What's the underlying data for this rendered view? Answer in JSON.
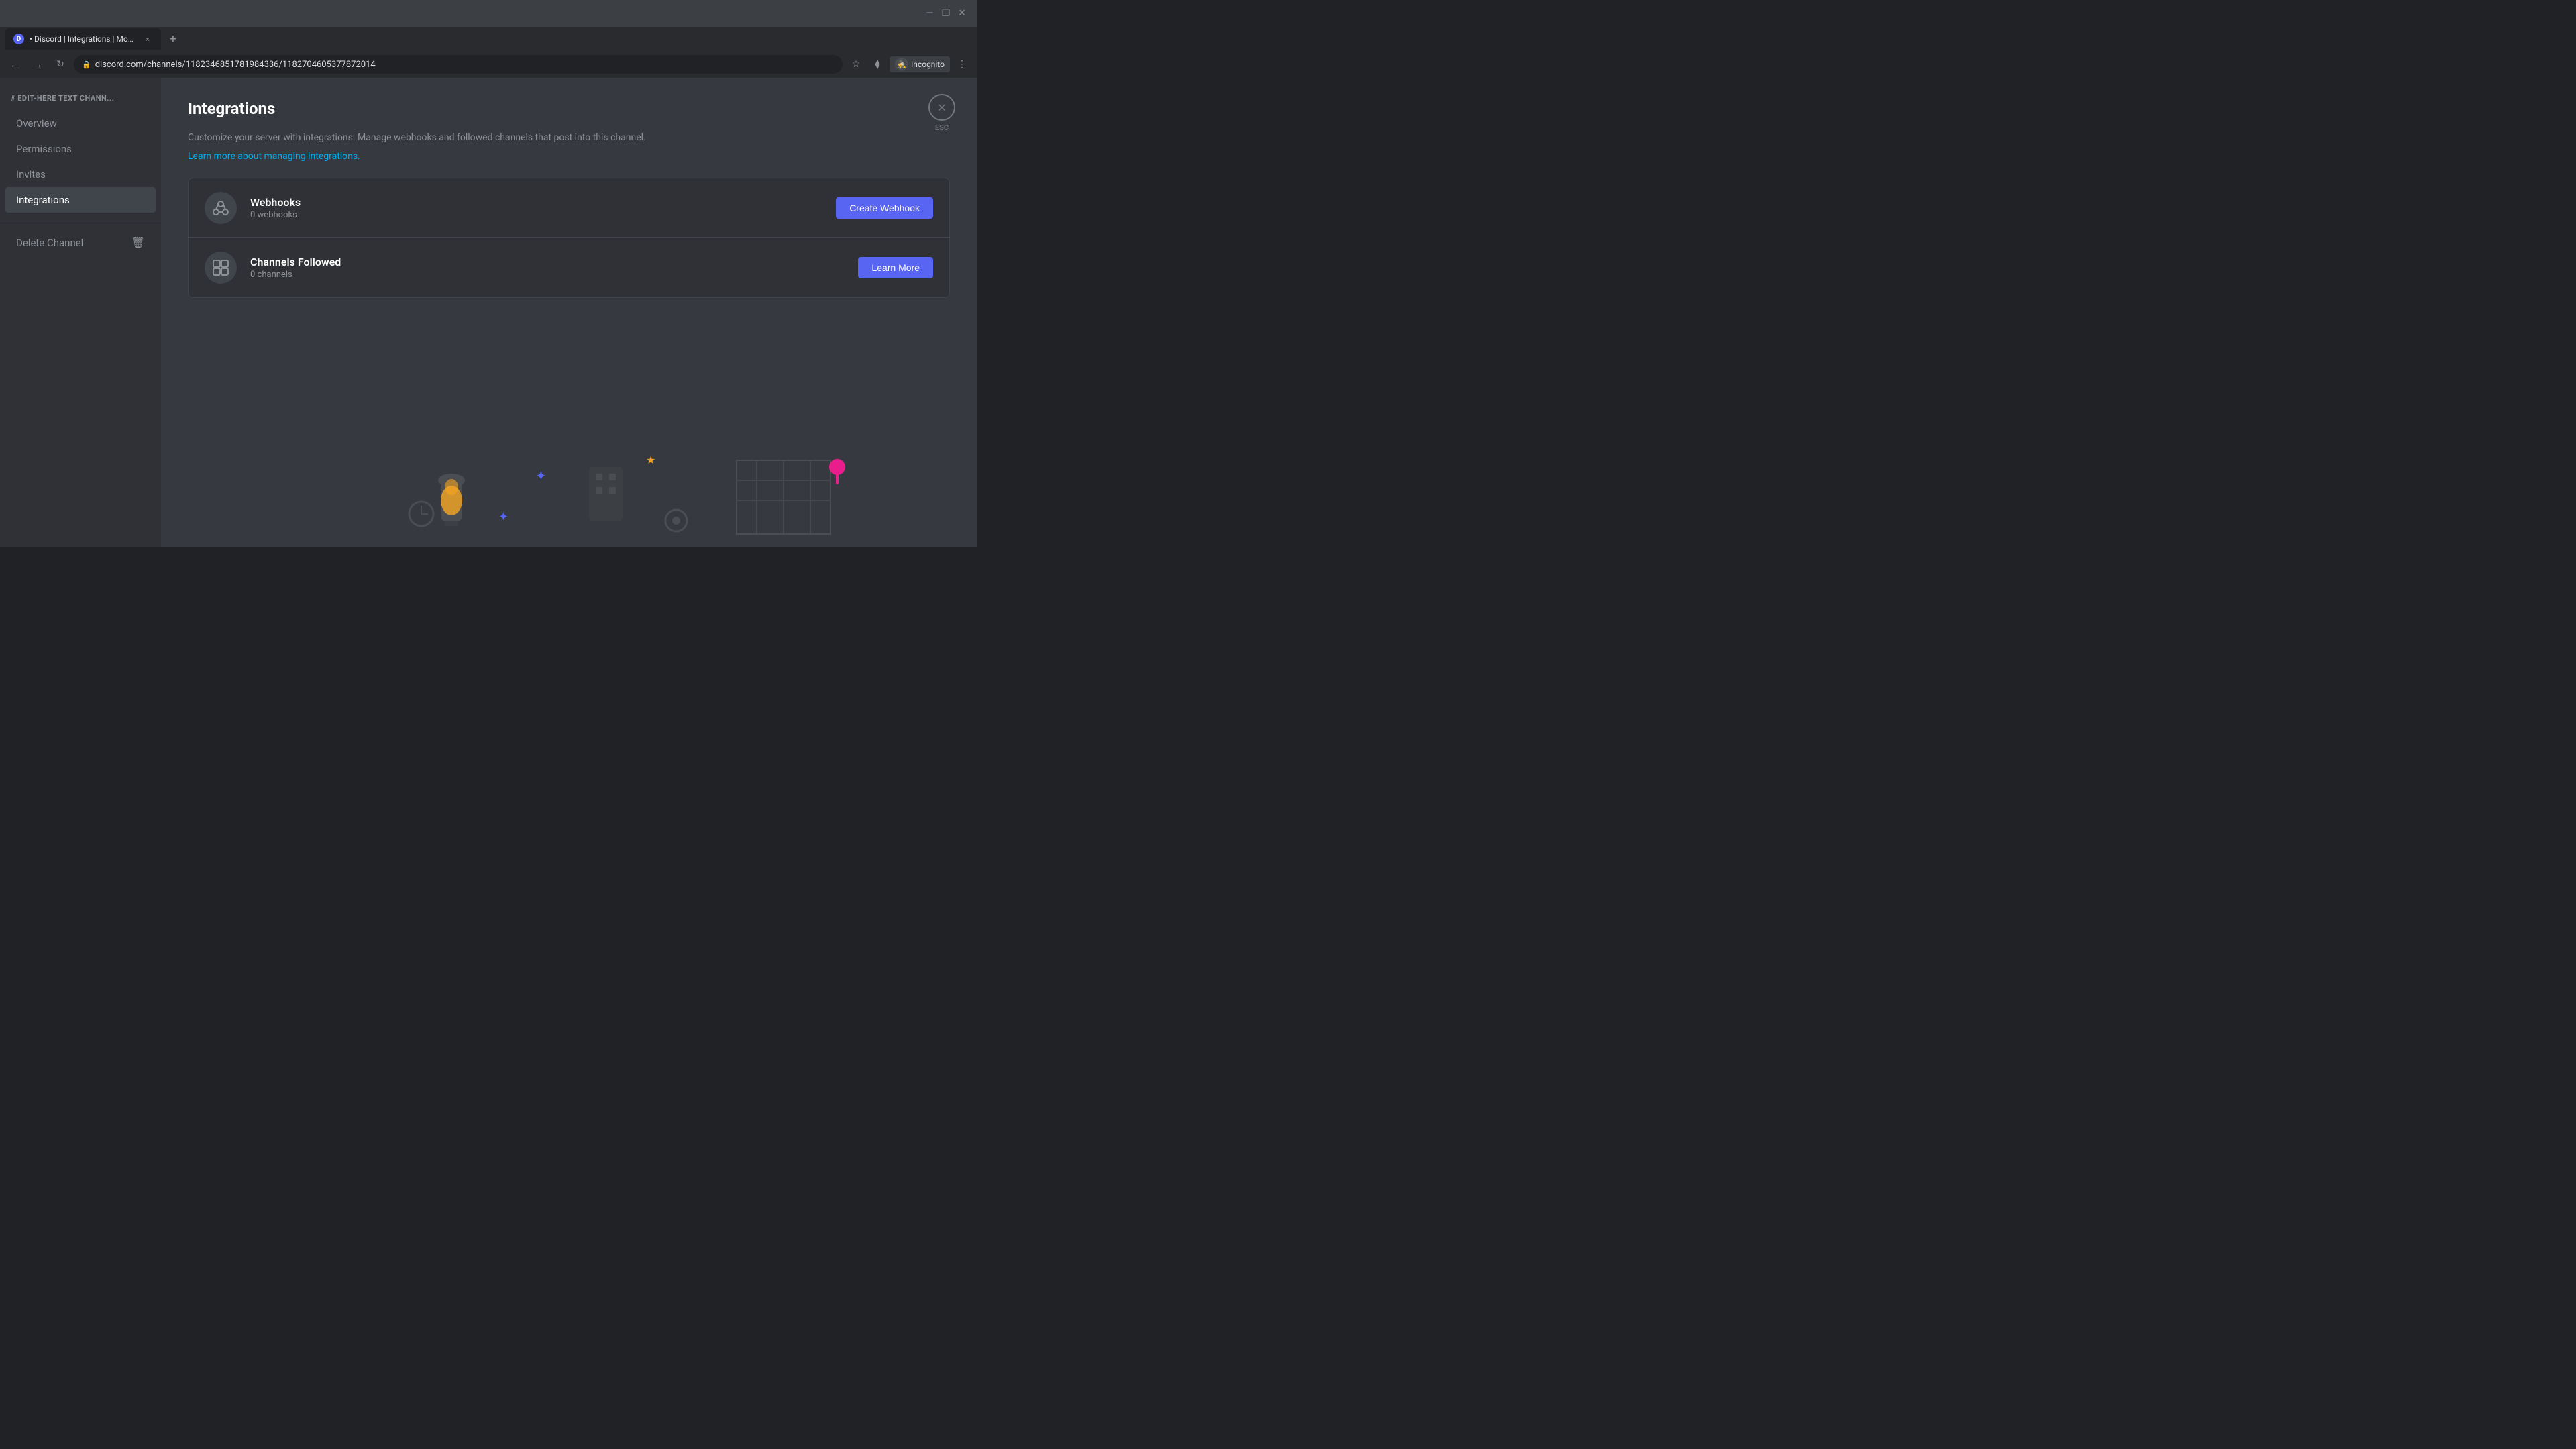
{
  "browser": {
    "tab": {
      "favicon": "D",
      "title": "• Discord | Integrations | Moodj...",
      "close_label": "×"
    },
    "new_tab_label": "+",
    "address": "discord.com/channels/1182346851781984336/1182704605377872014",
    "incognito_label": "Incognito",
    "window_controls": {
      "minimize": "—",
      "restore": "❐",
      "close": "✕"
    }
  },
  "sidebar": {
    "channel_name": "# EDIT-HERE TEXT CHANN...",
    "nav_items": [
      {
        "label": "Overview",
        "active": false
      },
      {
        "label": "Permissions",
        "active": false
      },
      {
        "label": "Invites",
        "active": false
      },
      {
        "label": "Integrations",
        "active": true
      },
      {
        "label": "Delete Channel",
        "active": false,
        "has_icon": true
      }
    ]
  },
  "main": {
    "title": "Integrations",
    "esc_label": "ESC",
    "description": "Customize your server with integrations. Manage webhooks and followed channels that post into this channel.",
    "learn_more_link": "Learn more about managing integrations.",
    "integrations": [
      {
        "id": "webhooks",
        "title": "Webhooks",
        "subtitle": "0 webhooks",
        "action_label": "Create Webhook",
        "action_type": "create"
      },
      {
        "id": "channels-followed",
        "title": "Channels Followed",
        "subtitle": "0 channels",
        "action_label": "Learn More",
        "action_type": "learn"
      }
    ]
  },
  "colors": {
    "accent": "#5865f2",
    "link": "#00b0f4",
    "bg_main": "#36393f",
    "bg_sidebar": "#2f3136",
    "text_primary": "#ffffff",
    "text_secondary": "#8e9297"
  }
}
